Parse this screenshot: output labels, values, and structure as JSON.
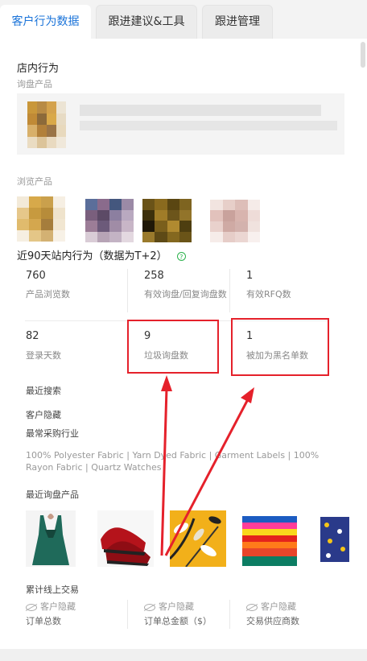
{
  "tabs": [
    {
      "label": "客户行为数据",
      "active": true
    },
    {
      "label": "跟进建议&工具",
      "active": false
    },
    {
      "label": "跟进管理",
      "active": false
    }
  ],
  "store": {
    "title": "店内行为",
    "inquiry_label": "询盘产品",
    "browse_label": "浏览产品"
  },
  "recent90": {
    "title": "近90天站内行为（数据为T+2）",
    "stats_row1": [
      {
        "value": "760",
        "label": "产品浏览数"
      },
      {
        "value": "258",
        "label": "有效询盘/回复询盘数"
      },
      {
        "value": "1",
        "label": "有效RFQ数"
      }
    ],
    "stats_row2": [
      {
        "value": "82",
        "label": "登录天数"
      },
      {
        "value": "9",
        "label": "垃圾询盘数"
      },
      {
        "value": "1",
        "label": "被加为黑名单数"
      }
    ]
  },
  "recent_search": {
    "title": "最近搜索",
    "hidden": "客户隐藏"
  },
  "industry": {
    "title": "最常采购行业",
    "text": "100% Polyester Fabric | Yarn Dyed Fabric | Garment Labels | 100% Rayon Fabric | Quartz Watches"
  },
  "recent_inquiry": {
    "title": "最近询盘产品"
  },
  "transactions": {
    "title": "累计线上交易",
    "items": [
      {
        "value": "客户隐藏",
        "label": "订单总数"
      },
      {
        "value": "客户隐藏",
        "label": "订单总金额（$）"
      },
      {
        "value": "客户隐藏",
        "label": "交易供应商数"
      }
    ]
  },
  "colors": {
    "accent": "#1a73d9",
    "highlight": "#e5212b"
  }
}
